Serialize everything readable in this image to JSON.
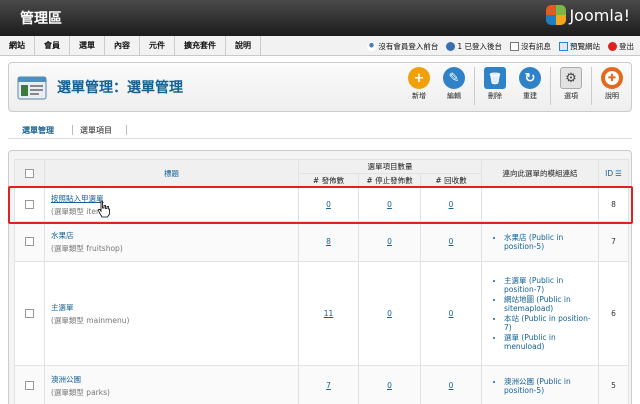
{
  "header": {
    "title": "管理區",
    "brand": "Joomla!"
  },
  "menu": [
    "網站",
    "會員",
    "選單",
    "內容",
    "元件",
    "擴充套件",
    "說明"
  ],
  "status": [
    {
      "icon": "frontend-users-icon",
      "label": "沒有會員登入前台"
    },
    {
      "icon": "backend-users-icon",
      "label": "1 已登入後台"
    },
    {
      "icon": "messages-icon",
      "label": "沒有訊息"
    },
    {
      "icon": "preview-site-icon",
      "label": "預覽網站"
    },
    {
      "icon": "logout-icon",
      "label": "登出"
    }
  ],
  "page": {
    "title": "選單管理：選單管理"
  },
  "toolbar": [
    {
      "name": "new",
      "label": "新增",
      "color": "#f0a10a",
      "glyph": "+"
    },
    {
      "name": "edit",
      "label": "編輯",
      "color": "#2f82c8",
      "glyph": "✎"
    },
    {
      "name": "delete",
      "label": "刪除",
      "color": "#2f82c8",
      "glyph": "🗑"
    },
    {
      "name": "rebuild",
      "label": "重建",
      "color": "#2f82c8",
      "glyph": "↻"
    },
    {
      "name": "options",
      "label": "選項",
      "color": "#d8d8d8",
      "glyph": "⚙"
    },
    {
      "name": "help",
      "label": "說明",
      "color": "#e36a1c",
      "glyph": "✚"
    }
  ],
  "tabs": [
    "選單管理",
    "選單項目"
  ],
  "table": {
    "headers": {
      "title": "標題",
      "menu_items": "選單項目數量",
      "published": "# 發佈數",
      "unpublished": "# 停止發佈數",
      "trashed": "# 回收數",
      "modules": "連向此選單的模組連結",
      "id": "ID"
    },
    "rows": [
      {
        "title": "按照貼入甲選單",
        "type": "(選單類型 item)",
        "published": "0",
        "unpublished": "0",
        "trashed": "0",
        "modules": [],
        "id": "8"
      },
      {
        "title": "水果店",
        "type": "(選單類型 fruitshop)",
        "published": "8",
        "unpublished": "0",
        "trashed": "0",
        "modules": [
          "水果店 (Public in position-5)"
        ],
        "id": "7"
      },
      {
        "title": "主選單",
        "type": "(選單類型 mainmenu)",
        "published": "11",
        "unpublished": "0",
        "trashed": "0",
        "modules": [
          "主選單 (Public in position-7)",
          "網站地圖 (Public in sitemapload)",
          "本站 (Public in position-7)",
          "選單 (Public in menuload)"
        ],
        "id": "6"
      },
      {
        "title": "澳洲公園",
        "type": "(選單類型 parks)",
        "published": "7",
        "unpublished": "0",
        "trashed": "0",
        "modules": [
          "澳洲公園 (Public in position-5)"
        ],
        "id": "5"
      }
    ]
  }
}
